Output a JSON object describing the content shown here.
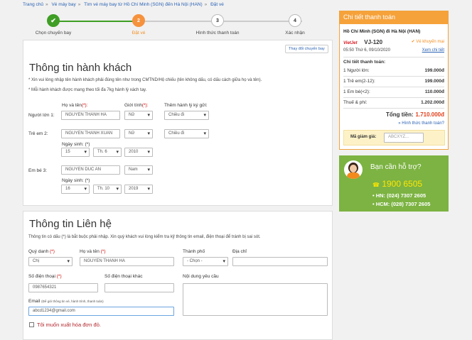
{
  "breadcrumb": [
    "Trang chủ",
    "Vé máy bay",
    "Tìm vé máy bay từ Hồ Chí Minh (SGN) đến Hà Nội (HAN)",
    "Đặt vé"
  ],
  "steps": [
    {
      "label": "Chọn chuyến bay",
      "num": "✔",
      "state": "done"
    },
    {
      "label": "Đặt vé",
      "num": "2",
      "state": "active"
    },
    {
      "label": "Hình thức thanh toán",
      "num": "3",
      "state": "pending"
    },
    {
      "label": "Xác nhận",
      "num": "4",
      "state": "pending"
    }
  ],
  "passengers": {
    "change_button": "Thay đổi chuyến bay",
    "title": "Thông tin hành khách",
    "note1": "* Xin vui lòng nhập tên hành khách phải đúng tên như trong CMTND/Hộ chiếu (tên không dấu, có dấu cách giữa họ và tên).",
    "note2": "* Mỗi hành khách được mang theo tối đa 7kg hành lý xách tay.",
    "col_name": "Họ và tên",
    "col_gender": "Giới tính",
    "col_baggage": "Thêm hành lý ký gửi:",
    "req": "(*):",
    "dob_label": "Ngày sinh: (*)",
    "rows": [
      {
        "label": "Người lớn 1:",
        "name": "NGUYEN THANH HA",
        "gender": "Nữ",
        "baggage": "Chiều đi"
      },
      {
        "label": "Trẻ em 2:",
        "name": "NGUYEN THANH XUAN",
        "gender": "Nữ",
        "baggage": "Chiều đi",
        "day": "15",
        "month": "Th. 6",
        "year": "2010"
      },
      {
        "label": "Em bé 3:",
        "name": "NGUYEN DUC AN",
        "gender": "Nam",
        "day": "16",
        "month": "Th. 10",
        "year": "2019"
      }
    ]
  },
  "contact": {
    "title": "Thông tin Liên hệ",
    "note": "Thông tin có dấu (*) là bắt buộc phải nhập. Xin quý khách vui lòng kiểm tra kỹ thông tin email, điện thoại để tránh bị sai sót.",
    "title_label": "Quý danh",
    "name_label": "Họ và tên",
    "city_label": "Thành phố",
    "address_label": "Địa chỉ",
    "phone_label": "Số điện thoại",
    "phone2_label": "Số điện thoại khác",
    "request_label": "Nội dung yêu cầu",
    "email_label": "Email",
    "email_hint": "(Để gửi thông tin vé, hành trình, thanh toán)",
    "req_mark": "(*)",
    "title_value": "Chị",
    "name_value": "NGUYEN THANH HA",
    "city_value": "- Chọn -",
    "phone_value": "0987654321",
    "email_value": "abcd1234@gmail.com",
    "invoice_label": "Tôi muốn xuất hóa đơn đỏ."
  },
  "summary": {
    "header": "Chi tiết thanh toán",
    "route": "Hồ Chí Minh (SGN) đi Hà Nội (HAN)",
    "airline_logo": "VietJet",
    "flight": "VJ-120",
    "promo": "Vé khuyến mại",
    "time": "05:50 Thứ 6, 09/10/2020",
    "detail_link": "Xem chi tiết",
    "section": "Chi tiết thanh toán:",
    "lines": [
      {
        "label": "1 Người lớn:",
        "value": "199.000đ"
      },
      {
        "label": "1 Trẻ em(2-12):",
        "value": "199.000đ"
      },
      {
        "label": "1 Em bé(<2):",
        "value": "110.000đ"
      },
      {
        "label": "Thuế & phí:",
        "value": "1.202.000đ"
      }
    ],
    "total_label": "Tổng tiền:",
    "total_value": "1.710.000đ",
    "payment_link": "» Hình thức thanh toán?",
    "discount_label": "Mã giảm giá:",
    "discount_placeholder": "ABCXYZ..."
  },
  "help": {
    "title": "Bạn cần hỗ trợ?",
    "hotline": "1900 6505",
    "hn": "HN: (024) 7307 2605",
    "hcm": "HCM: (028) 7307 2605"
  },
  "colors": {
    "accent": "#f6a23a",
    "success": "#3f9e25",
    "link": "#2b62b3",
    "help_bg": "#7cb342",
    "required": "#cc0000"
  }
}
